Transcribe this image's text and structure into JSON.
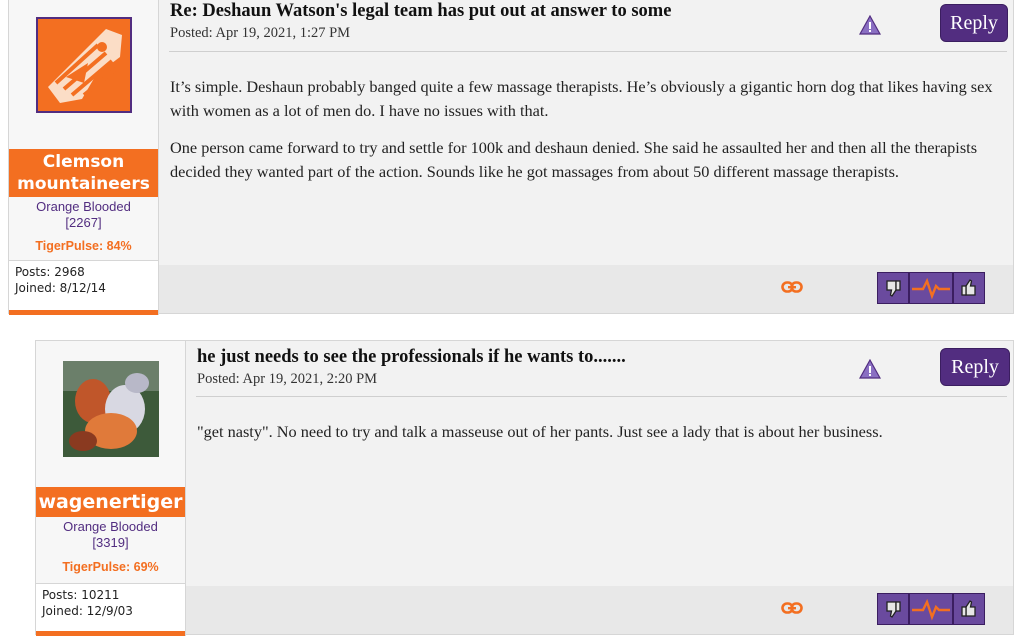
{
  "posts": [
    {
      "title": "Re: Deshaun Watson's legal team has put out at answer to some",
      "posted": "Posted: Apr 19, 2021, 1:27 PM",
      "reply_label": "Reply",
      "paragraphs": [
        "It’s simple. Deshaun probably banged quite a few massage therapists. He’s obviously a gigantic horn dog that likes having sex with women as a lot of men do. I have no issues with that.",
        "One person came forward to try and settle for 100k and deshaun denied. She said he assaulted her and then all the therapists decided they wanted part of the action. Sounds like he got massages from about 50 different massage therapists."
      ],
      "user": {
        "name_line1": "Clemson",
        "name_line2": "mountaineers",
        "rank": "Orange Blooded",
        "rank_points": "[2267]",
        "tigerpulse": "TigerPulse: 84%",
        "posts": "Posts: 2968",
        "joined": "Joined: 8/12/14"
      }
    },
    {
      "title": "he just needs to see the professionals if he wants to.......",
      "posted": "Posted: Apr 19, 2021, 2:20 PM",
      "reply_label": "Reply",
      "paragraphs": [
        "\"get nasty\". No need to try and talk a masseuse out of her pants. Just see a lady that is about her business."
      ],
      "user": {
        "name": "wagenertiger",
        "rank": "Orange Blooded",
        "rank_points": "[3319]",
        "tigerpulse": "TigerPulse: 69%",
        "posts": "Posts: 10211",
        "joined": "Joined: 12/9/03"
      }
    }
  ],
  "icons": {
    "warning": "warning-icon",
    "link": "link-icon",
    "thumbs_down": "thumbs-down-icon",
    "pulse": "tigerpulse-icon",
    "thumbs_up": "thumbs-up-icon"
  },
  "colors": {
    "orange": "#f36f21",
    "purple": "#522d80"
  }
}
